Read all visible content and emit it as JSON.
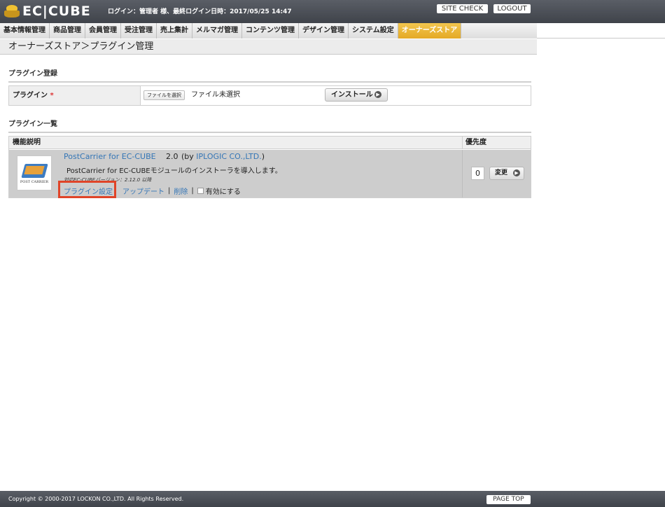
{
  "header": {
    "logo_text": "EC|CUBE",
    "login_info": "ログイン：管理者 様、最終ログイン日時：2017/05/25 14:47",
    "site_check": "SITE CHECK",
    "logout": "LOGOUT"
  },
  "nav": {
    "items": [
      {
        "label": "基本情報管理"
      },
      {
        "label": "商品管理"
      },
      {
        "label": "会員管理"
      },
      {
        "label": "受注管理"
      },
      {
        "label": "売上集計"
      },
      {
        "label": "メルマガ管理"
      },
      {
        "label": "コンテンツ管理"
      },
      {
        "label": "デザイン管理"
      },
      {
        "label": "システム設定"
      },
      {
        "label": "オーナーズストア"
      }
    ],
    "active": "オーナーズストア"
  },
  "page": {
    "title": "オーナーズストア＞プラグイン管理"
  },
  "register": {
    "heading": "プラグイン登録",
    "label": "プラグイン",
    "required_mark": "*",
    "file_button": "ファイルを選択",
    "file_status": "ファイル未選択",
    "install_button": "インストール"
  },
  "list": {
    "heading": "プラグイン一覧",
    "col_desc": "機能説明",
    "col_priority": "優先度",
    "plugins": [
      {
        "logo_text": "POST CARRIER",
        "name": "PostCarrier for EC-CUBE",
        "version": "2.0",
        "by_prefix": "(by ",
        "author": "IPLOGIC CO.,LTD.",
        "by_suffix": ")",
        "description": "PostCarrier for EC-CUBEモジュールのインストーラを導入します。",
        "compat": "対応EC-CUBEバージョン：2.12.0 以降",
        "settings_link": "プラグイン設定",
        "update_link": "アップデート",
        "delete_link": "削除",
        "separator": "|",
        "enable_label": "有効にする",
        "enabled": false,
        "priority": "0",
        "change_button": "変更"
      }
    ]
  },
  "footer": {
    "copyright": "Copyright © 2000-2017 LOCKON CO.,LTD. All Rights Reserved.",
    "page_top": "PAGE TOP"
  },
  "colors": {
    "header_bg": "#4a4e56",
    "nav_active": "#e9b33a",
    "link": "#3576b6",
    "highlight": "#e04428"
  }
}
